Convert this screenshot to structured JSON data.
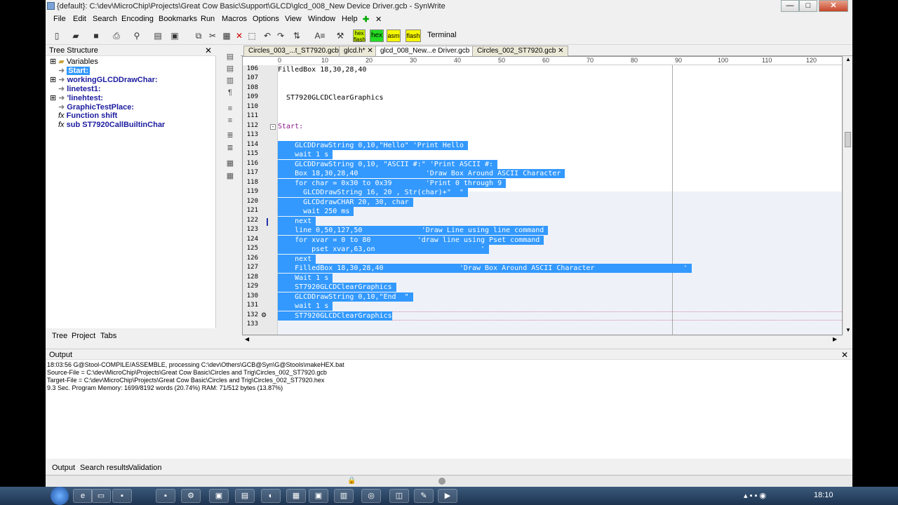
{
  "window": {
    "title": "{default}: C:\\dev\\MicroChip\\Projects\\Great Cow Basic\\Support\\GLCD\\glcd_008_New Device Driver.gcb - SynWrite",
    "minimize": "—",
    "maximize": "□",
    "close": "✕"
  },
  "menu": [
    "File",
    "Edit",
    "Search",
    "Encoding",
    "Bookmarks",
    "Run",
    "Macros",
    "Options",
    "View",
    "Window",
    "Help"
  ],
  "toolbar": {
    "hex_flash": "hex flash",
    "hex": "hex",
    "asm": "asm",
    "flash": "flash",
    "terminal": "Terminal"
  },
  "tree_panel": {
    "title": "Tree Structure",
    "close": "✕",
    "items": [
      {
        "label": "Variables",
        "kind": "folder"
      },
      {
        "label": "Start:",
        "kind": "label",
        "selected": true
      },
      {
        "label": "workingGLCDDrawChar:",
        "kind": "label"
      },
      {
        "label": "linetest1:",
        "kind": "label"
      },
      {
        "label": "'linehtest:",
        "kind": "label"
      },
      {
        "label": "GraphicTestPlace:",
        "kind": "label"
      },
      {
        "label": "Function shift",
        "kind": "function"
      },
      {
        "label": "sub ST7920CallBuiltinChar",
        "kind": "function"
      }
    ],
    "tabs": [
      "Tree",
      "Project",
      "Tabs"
    ]
  },
  "file_tabs": [
    "Circles_003_...t_ST7920.gcb",
    "glcd.h*",
    "glcd_008_New...e Driver.gcb",
    "Circles_002_ST7920.gcb"
  ],
  "ruler_marks": [
    "0",
    "10",
    "20",
    "30",
    "40",
    "50",
    "60",
    "70",
    "80",
    "90",
    "100",
    "110",
    "120"
  ],
  "code_lines": [
    {
      "n": "106",
      "text": "FilledBox 18,30,28,40"
    },
    {
      "n": "107",
      "text": ""
    },
    {
      "n": "108",
      "text": ""
    },
    {
      "n": "109",
      "text": "  ST7920GLCDClearGraphics"
    },
    {
      "n": "110",
      "text": ""
    },
    {
      "n": "111",
      "text": ""
    },
    {
      "n": "112",
      "text": "Start:"
    },
    {
      "n": "113",
      "text": ""
    },
    {
      "n": "114",
      "text": "    GLCDDrawString 0,10,\"Hello\" 'Print Hello "
    },
    {
      "n": "115",
      "text": "    wait 1 s "
    },
    {
      "n": "116",
      "text": "    GLCDDrawString 0,10, \"ASCII #:\" 'Print ASCII #: "
    },
    {
      "n": "117",
      "text": "    Box 18,30,28,40                'Draw Box Around ASCII Character "
    },
    {
      "n": "118",
      "text": "    for char = 0x30 to 0x39        'Print 0 through 9 "
    },
    {
      "n": "119",
      "text": "      GLCDDrawString 16, 20 , Str(char)+\"  \" "
    },
    {
      "n": "120",
      "text": "      GLCDdrawCHAR 20, 30, char "
    },
    {
      "n": "121",
      "text": "      wait 250 ms "
    },
    {
      "n": "122",
      "text": "    next "
    },
    {
      "n": "123",
      "text": "    line 0,50,127,50              'Draw Line using line command "
    },
    {
      "n": "124",
      "text": "    for xvar = 0 to 80           'draw line using Pset command "
    },
    {
      "n": "125",
      "text": "        pset xvar,63,on                         ' "
    },
    {
      "n": "126",
      "text": "    next "
    },
    {
      "n": "127",
      "text": "    FilledBox 18,30,28,40                  'Draw Box Around ASCII Character                     ' "
    },
    {
      "n": "128",
      "text": "    Wait 1 s "
    },
    {
      "n": "129",
      "text": "    ST7920GLCDClearGraphics "
    },
    {
      "n": "130",
      "text": "    GLCDDrawString 0,10,\"End  \" "
    },
    {
      "n": "131",
      "text": "    wait 1 s "
    },
    {
      "n": "132",
      "text": "    ST7920GLCDClearGraphics"
    },
    {
      "n": "133",
      "text": ""
    }
  ],
  "output_panel": {
    "title": "Output",
    "close": "✕",
    "lines": [
      "18:03:56    G@Stool-COMPILE/ASSEMBLE, processing    C:\\dev\\Others\\GCB@Syn\\G@Stools\\makeHEX.bat",
      "Source-File  = C:\\dev\\MicroChip\\Projects\\Great Cow Basic\\Circles and Trig\\Circles_002_ST7920.gcb",
      "Target-File  = C:\\dev\\MicroChip\\Projects\\Great Cow Basic\\Circles and Trig\\Circles_002_ST7920.hex",
      "  9.3 Sec.    Program Memory: 1699/8192 words (20.74%)    RAM: 71/512 bytes (13.87%)"
    ],
    "tabs": [
      "Output",
      "Search results",
      "Validation"
    ]
  },
  "taskbar": {
    "clock": "18:10"
  }
}
